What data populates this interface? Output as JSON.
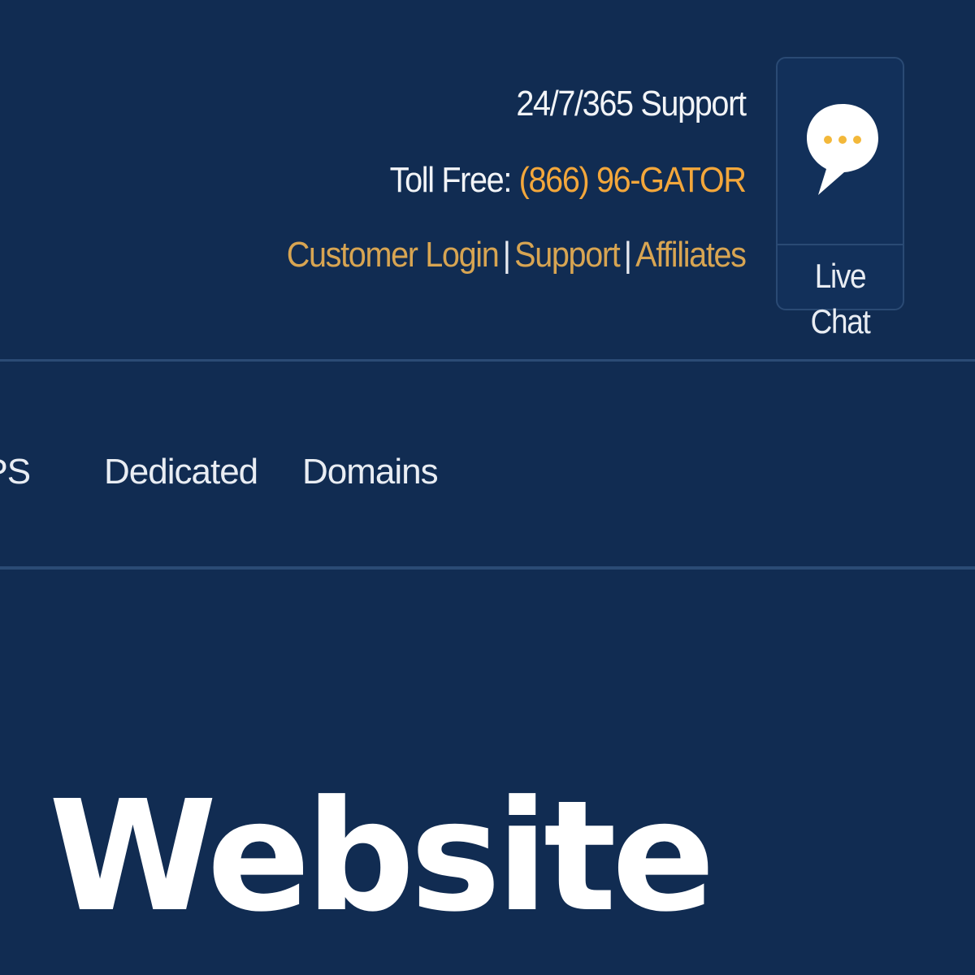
{
  "header": {
    "support_hours": "24/7/365 Support",
    "toll_free_label": "Toll Free: ",
    "phone_number": "(866) 96-GATOR",
    "links": {
      "customer_login": "Customer Login",
      "support": "Support",
      "affiliates": "Affiliates",
      "separator": "|"
    },
    "live_chat_label": "Live Chat",
    "chat_icon": "chat-bubble-icon"
  },
  "nav": {
    "items": [
      "VPS",
      "Dedicated",
      "Domains"
    ]
  },
  "hero": {
    "title_fragment": "l Website"
  },
  "colors": {
    "background": "#112c52",
    "accent": "#f3a73b",
    "link": "#d8a552",
    "divider": "#2b4b75",
    "text": "#ffffff"
  }
}
